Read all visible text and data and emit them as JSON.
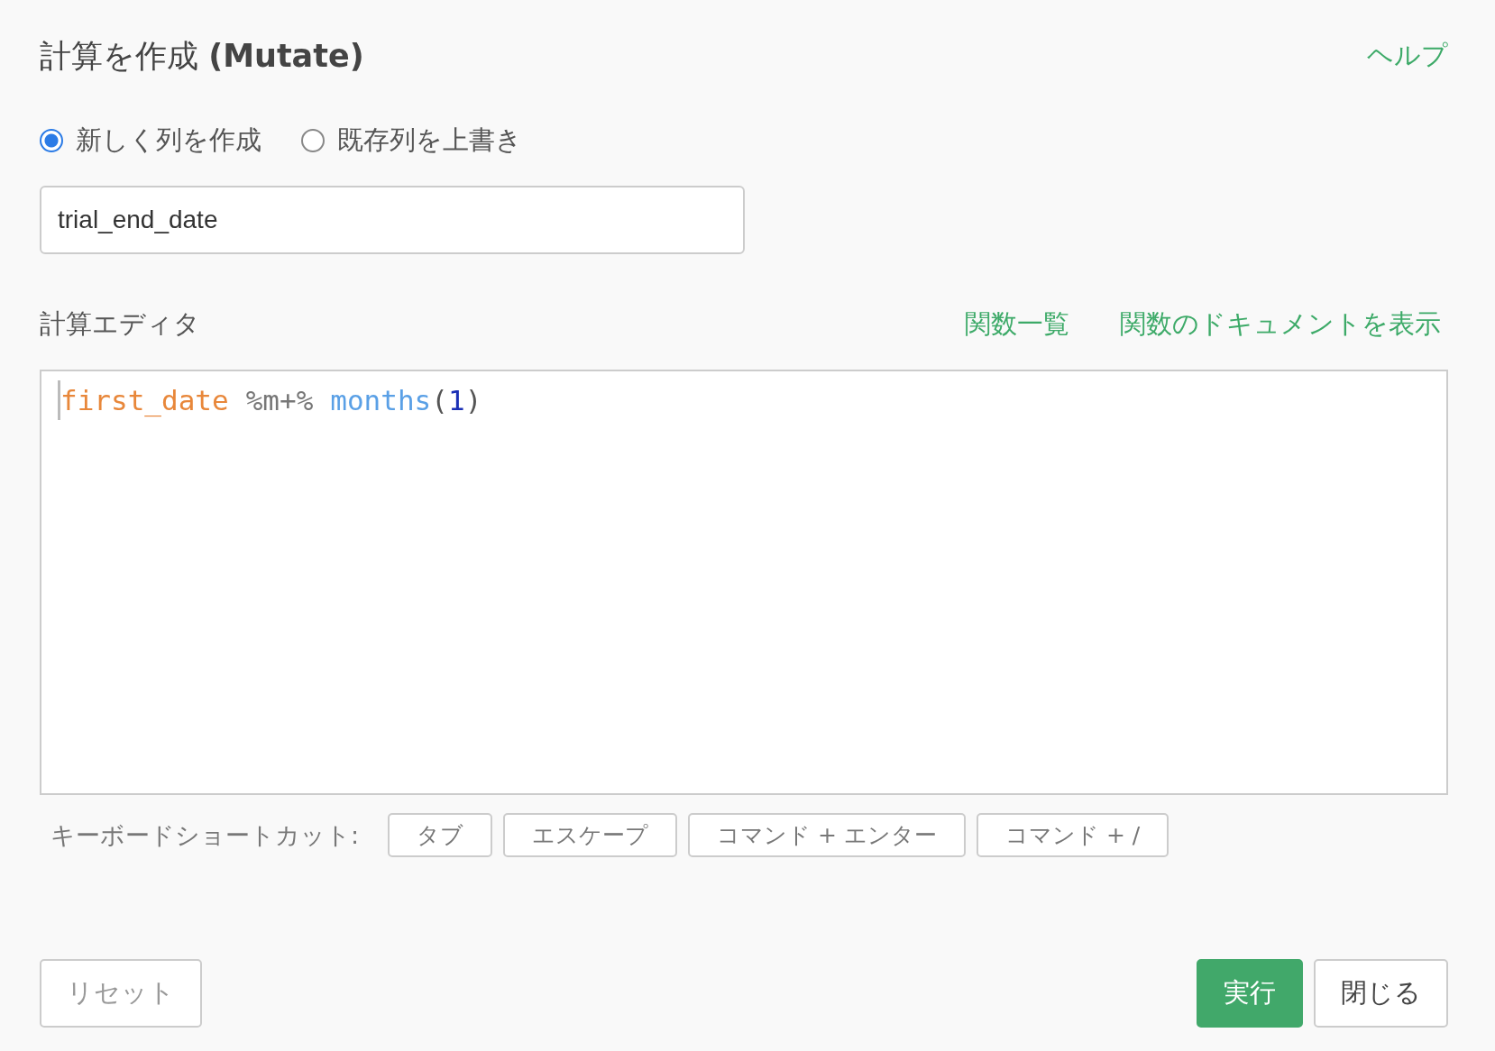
{
  "title": "計算を作成 **(Mutate)**",
  "help_link": "ヘルプ",
  "mode_options": [
    {
      "label": "新しく列を作成",
      "selected": true
    },
    {
      "label": "既存列を上書き",
      "selected": false
    }
  ],
  "column_name": {
    "value": "trial_end_date"
  },
  "editor": {
    "label": "計算エディタ",
    "links": [
      "関数一覧",
      "関数のドキュメントを表示"
    ],
    "code_tokens": [
      {
        "text": "first_date",
        "kind": "variable"
      },
      {
        "text": "%m+%",
        "kind": "operator"
      },
      {
        "text": "months",
        "kind": "function"
      },
      {
        "text": "(",
        "kind": "paren"
      },
      {
        "text": "1",
        "kind": "number"
      },
      {
        "text": ")",
        "kind": "paren"
      }
    ]
  },
  "shortcuts": {
    "label": "キーボードショートカット:",
    "keys": [
      "タブ",
      "エスケープ",
      "コマンド + エンター",
      "コマンド + /"
    ]
  },
  "buttons": {
    "reset": "リセット",
    "run": "実行",
    "close": "閉じる"
  }
}
